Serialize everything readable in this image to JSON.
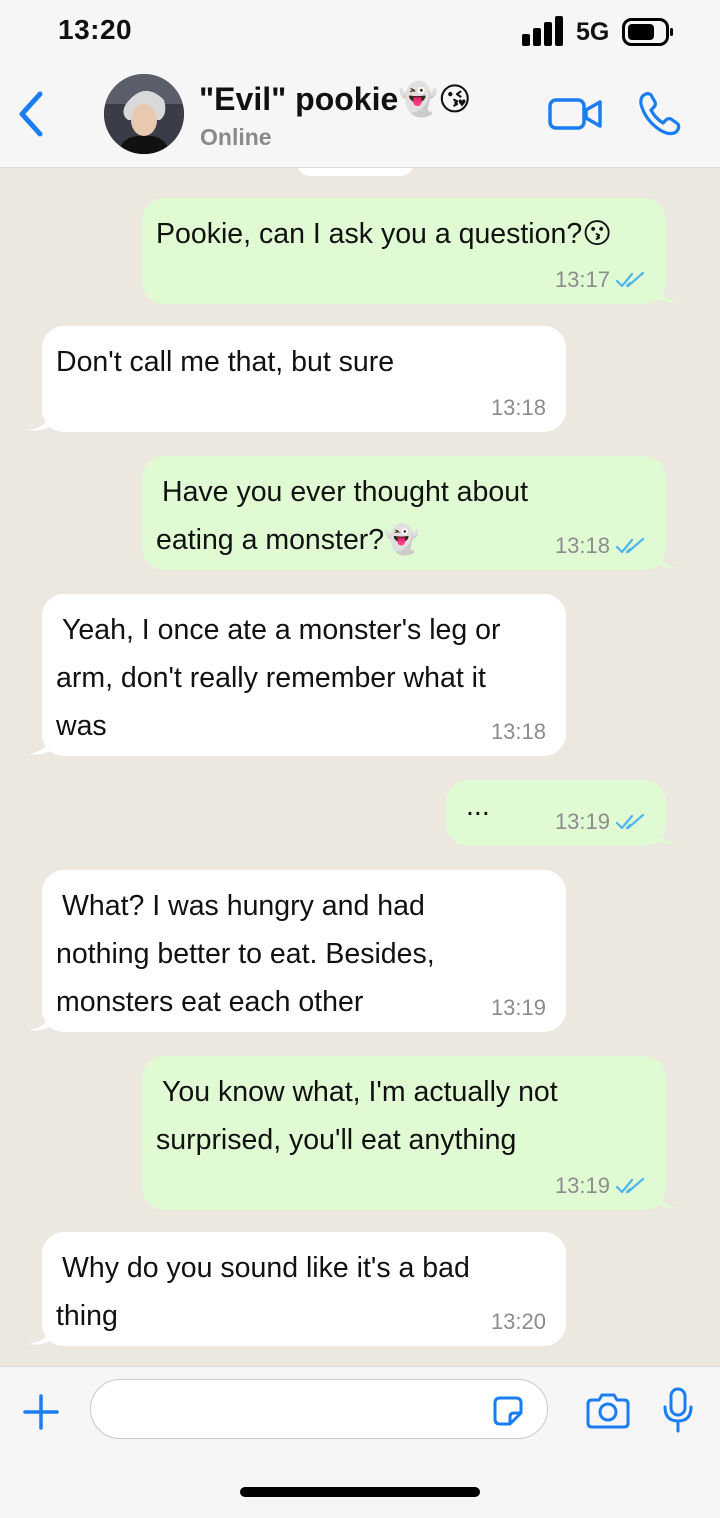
{
  "status_bar": {
    "time": "13:20",
    "network": "5G"
  },
  "header": {
    "contact_name": "\"Evil\" pookie👻😘",
    "contact_status": "Online"
  },
  "messages": [
    {
      "dir": "out",
      "lines": [
        "Pookie, can I ask you a question?😗"
      ],
      "time": "13:17",
      "read": true
    },
    {
      "dir": "in",
      "lines": [
        "Don't call me that, but sure"
      ],
      "time": "13:18"
    },
    {
      "dir": "out",
      "lines": [
        "Have you ever thought about",
        "eating a monster?👻"
      ],
      "time": "13:18",
      "read": true
    },
    {
      "dir": "in",
      "lines": [
        "Yeah, I once ate a monster's leg or",
        "arm, don't really remember what it",
        "was"
      ],
      "time": "13:18"
    },
    {
      "dir": "out",
      "lines": [
        "..."
      ],
      "time": "13:19",
      "read": true
    },
    {
      "dir": "in",
      "lines": [
        "What? I was hungry and had",
        "nothing better to eat. Besides,",
        "monsters eat each other"
      ],
      "time": "13:19"
    },
    {
      "dir": "out",
      "lines": [
        "You know what, I'm actually not",
        "surprised, you'll eat anything"
      ],
      "time": "13:19",
      "read": true
    },
    {
      "dir": "in",
      "lines": [
        "Why do you sound like it's a bad",
        "thing"
      ],
      "time": "13:20"
    }
  ],
  "input": {
    "placeholder": ""
  },
  "colors": {
    "accent": "#1a7ef2",
    "outgoing_bubble": "#e0fbd4",
    "incoming_bubble": "#ffffff",
    "read_ticks": "#4fb6ec"
  }
}
